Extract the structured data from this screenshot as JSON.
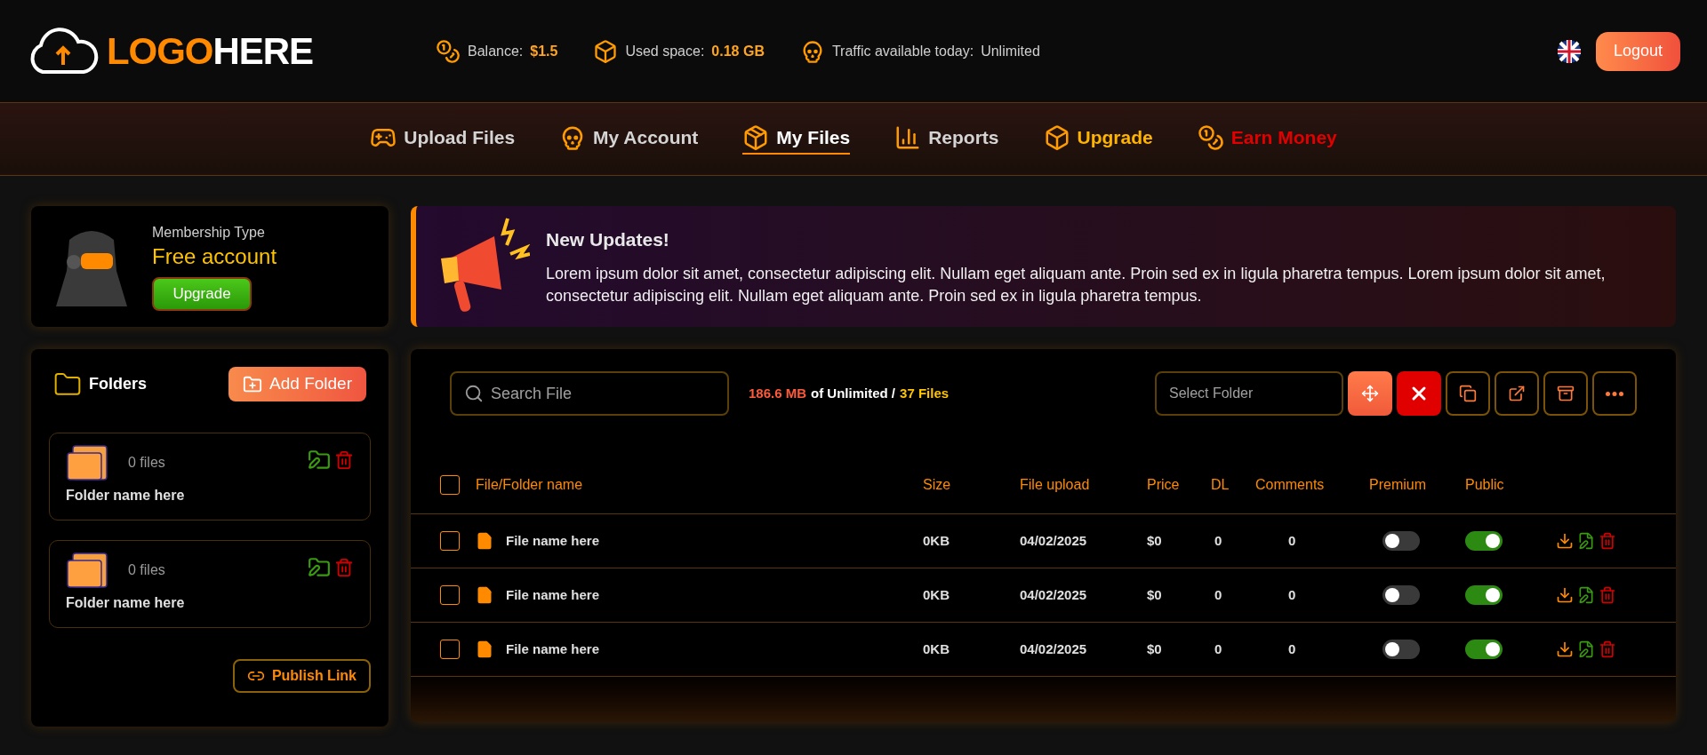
{
  "header": {
    "logo": {
      "part_1": "LOGO",
      "part_2": "HERE"
    },
    "stats": [
      {
        "label": "Balance:",
        "value": "$1.5"
      },
      {
        "label": "Used space:",
        "value": "0.18 GB"
      },
      {
        "label": "Traffic available today:",
        "value": "Unlimited"
      }
    ],
    "logout": "Logout"
  },
  "nav": [
    {
      "label": "Upload Files",
      "selected": false,
      "color": "#d4d4d4"
    },
    {
      "label": "My Account",
      "selected": false,
      "color": "#d4d4d4"
    },
    {
      "label": "My Files",
      "selected": true,
      "color": "#ffffff"
    },
    {
      "label": "Reports",
      "selected": false,
      "color": "#d4d4d4"
    },
    {
      "label": "Upgrade",
      "selected": false,
      "color": "#ffb400"
    },
    {
      "label": "Earn Money",
      "selected": false,
      "color": "#e00000"
    }
  ],
  "membership": {
    "label": "Membership Type",
    "type": "Free account",
    "button": "Upgrade"
  },
  "updates": {
    "title": "New Updates!",
    "text": "Lorem ipsum dolor sit amet, consectetur adipiscing elit. Nullam eget aliquam ante. Proin sed ex in ligula pharetra tempus. Lorem ipsum dolor sit amet, consectetur adipiscing elit. Nullam eget aliquam ante. Proin sed ex in ligula pharetra tempus."
  },
  "folders": {
    "title": "Folders",
    "add_button": "Add Folder",
    "items": [
      {
        "count": "0 files",
        "name": "Folder name here"
      },
      {
        "count": "0 files",
        "name": "Folder name here"
      }
    ],
    "publish_button": "Publish Link"
  },
  "files": {
    "search": {
      "placeholder": "Search File"
    },
    "usage": {
      "used": "186.6 MB",
      "of": "of Unlimited /",
      "files": "37 Files"
    },
    "folder_select": {
      "placeholder": "Select Folder"
    },
    "columns": [
      "File/Folder name",
      "Size",
      "File upload",
      "Price",
      "DL",
      "Comments",
      "Premium",
      "Public"
    ],
    "select_all_checked": false,
    "rows": [
      {
        "checked": false,
        "name": "File name here",
        "size": "0KB",
        "uploaded": "04/02/2025",
        "price": "$0",
        "dl": "0",
        "comments": "0",
        "premium": false,
        "public": true
      },
      {
        "checked": false,
        "name": "File name here",
        "size": "0KB",
        "uploaded": "04/02/2025",
        "price": "$0",
        "dl": "0",
        "comments": "0",
        "premium": false,
        "public": true
      },
      {
        "checked": false,
        "name": "File name here",
        "size": "0KB",
        "uploaded": "04/02/2025",
        "price": "$0",
        "dl": "0",
        "comments": "0",
        "premium": false,
        "public": true
      }
    ]
  }
}
